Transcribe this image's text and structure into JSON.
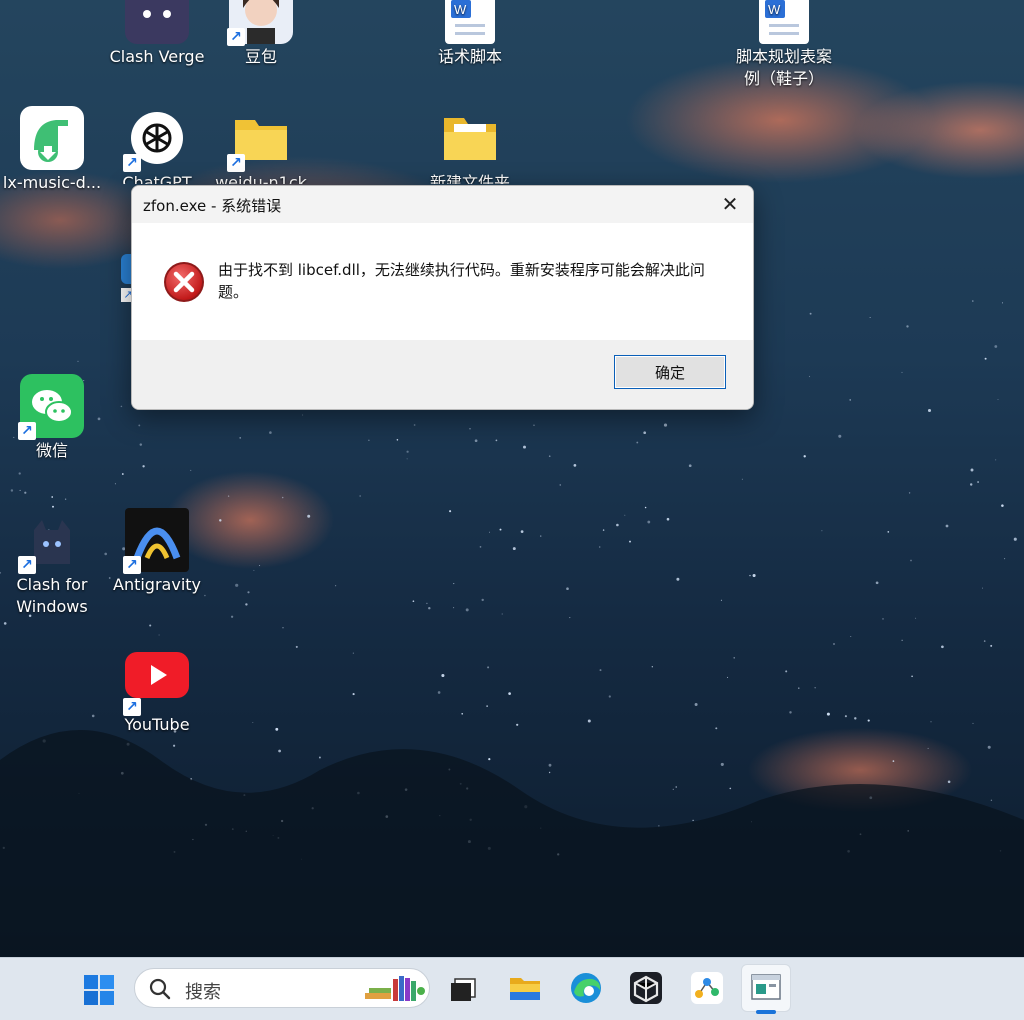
{
  "desktop": {
    "icons": [
      {
        "label": "Clash Verge",
        "icon": "clash-verge-cat-icon",
        "shortcut": false
      },
      {
        "label": "豆包",
        "icon": "doubao-avatar-icon",
        "shortcut": true
      },
      {
        "label": "话术脚本",
        "icon": "word-document-icon",
        "shortcut": false
      },
      {
        "label": "脚本规划表案例（鞋子）",
        "icon": "word-document-icon",
        "shortcut": false
      },
      {
        "label": "lx-music-d...",
        "icon": "lx-music-icon",
        "shortcut": false
      },
      {
        "label": "ChatGPT",
        "icon": "chatgpt-icon",
        "shortcut": true
      },
      {
        "label": "weidu-n1ck",
        "icon": "folder-icon",
        "shortcut": true
      },
      {
        "label": "新建文件夹",
        "icon": "folder-icon",
        "shortcut": false
      },
      {
        "label": "微信",
        "icon": "wechat-icon",
        "shortcut": true
      },
      {
        "label": "Clash for Windows",
        "icon": "clash-cat-icon",
        "shortcut": true
      },
      {
        "label": "Antigravity",
        "icon": "antigravity-icon",
        "shortcut": true
      },
      {
        "label": "YouTube",
        "icon": "youtube-icon",
        "shortcut": true
      }
    ]
  },
  "dialog": {
    "title": "zfon.exe - 系统错误",
    "close_glyph": "✕",
    "message": "由于找不到 libcef.dll，无法继续执行代码。重新安装程序可能会解决此问题。",
    "ok_label": "确定",
    "icon": "error-icon"
  },
  "taskbar": {
    "search_placeholder": "搜索",
    "items": [
      {
        "name": "start-button",
        "icon": "windows-logo-icon"
      },
      {
        "name": "task-view-button",
        "icon": "task-view-icon"
      },
      {
        "name": "file-explorer-button",
        "icon": "folder-icon"
      },
      {
        "name": "edge-button",
        "icon": "edge-icon"
      },
      {
        "name": "app-button",
        "icon": "cube-app-icon"
      },
      {
        "name": "app-button",
        "icon": "nodes-app-icon"
      },
      {
        "name": "active-window-button",
        "icon": "window-icon"
      }
    ]
  },
  "colors": {
    "accent": "#1a73d9",
    "error_red": "#d42a2a"
  }
}
